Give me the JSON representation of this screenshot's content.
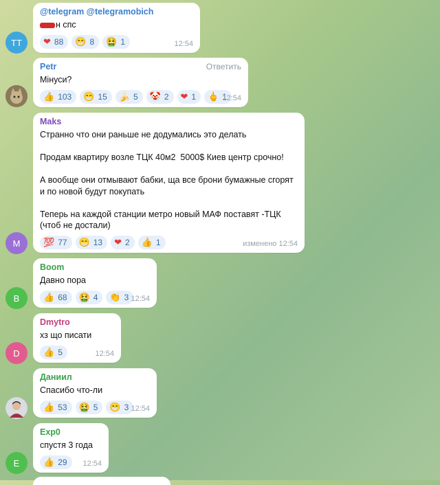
{
  "messages": [
    {
      "sender": "@telegram @telegramobich",
      "sender_color": "#3a7fd1",
      "avatar_text": "TT",
      "avatar_color": "#3fa7dd",
      "text": "н спс",
      "time": "12:54",
      "reactions": [
        {
          "emoji": "❤",
          "count": "88"
        },
        {
          "emoji": "😁",
          "count": "8"
        },
        {
          "emoji": "🤮",
          "count": "1"
        }
      ]
    },
    {
      "sender": "Petr",
      "sender_color": "#3a7fd1",
      "avatar_text": "",
      "avatar_color": "#8a7a5a",
      "reply": "Ответить",
      "text": "Мінуси?",
      "time": "12:54",
      "reactions": [
        {
          "emoji": "👍",
          "count": "103"
        },
        {
          "emoji": "😁",
          "count": "15"
        },
        {
          "emoji": "🍌",
          "count": "5"
        },
        {
          "emoji": "🤡",
          "count": "2"
        },
        {
          "emoji": "❤",
          "count": "1"
        },
        {
          "emoji": "🖕",
          "count": "1"
        }
      ]
    },
    {
      "sender": "Maks",
      "sender_color": "#7d4ab6",
      "avatar_text": "M",
      "avatar_color": "#9a6fd6",
      "text": "Странно что они раньше не додумались это делать\n\nПродам квартиру возле ТЦК 40м2  5000$ Киев центр срочно!\n\nА вообще они отмывают бабки, ща все брони бумажные сгорят\nи по новой будут покупать\n\nТеперь на каждой станции метро новый МАФ поставят -ТЦК\n(чтоб не достали)",
      "time": "изменено 12:54",
      "reactions": [
        {
          "emoji": "💯",
          "count": "77"
        },
        {
          "emoji": "😁",
          "count": "13"
        },
        {
          "emoji": "❤",
          "count": "2"
        },
        {
          "emoji": "👍",
          "count": "1"
        }
      ]
    },
    {
      "sender": "Boom",
      "sender_color": "#3aa24a",
      "avatar_text": "B",
      "avatar_color": "#4fbf4f",
      "text": "Давно пора",
      "time": "12:54",
      "reactions": [
        {
          "emoji": "👍",
          "count": "68"
        },
        {
          "emoji": "🤮",
          "count": "4"
        },
        {
          "emoji": "👏",
          "count": "3"
        }
      ]
    },
    {
      "sender": "Dmytro",
      "sender_color": "#c2427a",
      "avatar_text": "D",
      "avatar_color": "#e25b8f",
      "text": "хз що писати",
      "time": "12:54",
      "reactions": [
        {
          "emoji": "👍",
          "count": "5"
        }
      ]
    },
    {
      "sender": "Даниил",
      "sender_color": "#3aa24a",
      "avatar_text": "",
      "avatar_color": "#7a8a9a",
      "text": "Спасибо что-ли",
      "time": "12:54",
      "reactions": [
        {
          "emoji": "👍",
          "count": "53"
        },
        {
          "emoji": "🤮",
          "count": "5"
        },
        {
          "emoji": "😁",
          "count": "3"
        }
      ]
    },
    {
      "sender": "Exp0",
      "sender_color": "#3aa24a",
      "avatar_text": "E",
      "avatar_color": "#4fbf4f",
      "text": "спустя 3 года",
      "time": "12:54",
      "reactions": [
        {
          "emoji": "👍",
          "count": "29"
        }
      ]
    }
  ]
}
